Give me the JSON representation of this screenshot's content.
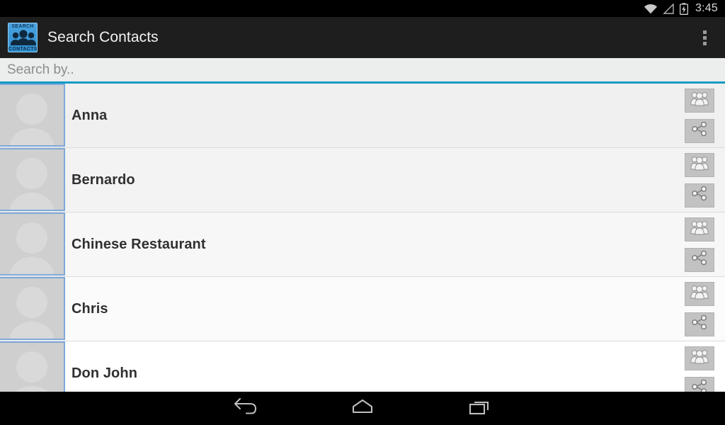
{
  "status_bar": {
    "time": "3:45",
    "icons": [
      "wifi-icon",
      "signal-icon",
      "battery-charging-icon"
    ]
  },
  "action_bar": {
    "app_icon": {
      "name": "search-contacts-app-icon",
      "top_text": "SEARCH",
      "bottom_text": "CONTACTS",
      "background_color": "#3f98d6"
    },
    "title": "Search Contacts",
    "overflow_label": "overflow-menu"
  },
  "search": {
    "value": "",
    "placeholder": "Search by..",
    "underline_color": "#0f9bc4"
  },
  "contacts": {
    "row_action_icons": [
      "group-icon",
      "share-icon"
    ],
    "items": [
      {
        "name": "Anna",
        "avatar": "default-contact-avatar"
      },
      {
        "name": "Bernardo",
        "avatar": "default-contact-avatar"
      },
      {
        "name": "Chinese Restaurant",
        "avatar": "default-contact-avatar"
      },
      {
        "name": "Chris",
        "avatar": "default-contact-avatar"
      },
      {
        "name": "Don John",
        "avatar": "default-contact-avatar"
      }
    ]
  },
  "nav_bar": {
    "buttons": [
      "back-icon",
      "home-icon",
      "recent-apps-icon"
    ]
  },
  "colors": {
    "action_bar_bg": "#1e1e1e",
    "accent": "#0f9bc4",
    "avatar_border": "#7fa9d8",
    "name_text": "#303030"
  }
}
